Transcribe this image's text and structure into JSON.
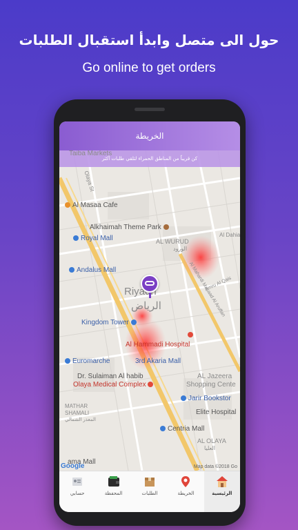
{
  "promo": {
    "title_ar": "حول الى متصل وابدأ استقبال الطلبات",
    "title_en": "Go online to get orders"
  },
  "screen": {
    "app_title": "الخريطة",
    "banner": "كن قريباً من المناطق الحمراء لتلقي طلبات أكثر"
  },
  "map": {
    "labels": {
      "taiba": "Taiba Markets",
      "al_masaa": "Al Masaa Cafe",
      "alkhaimah": "Alkhaimah Theme Park",
      "royal_mall": "Royal Mall",
      "al_wurud": "AL WURUD",
      "al_wurud_ar": "الورود",
      "al_dahia": "Al Dahia",
      "andalus": "Andalus Mall",
      "al_mahardi": "Al Mahardi Masaad Al Aruffan",
      "amru": "Amru Al Qais",
      "riyadh": "Riyadh",
      "riyadh_ar": "الرياض",
      "kingdom": "Kingdom Tower",
      "hammadi": "Al Hammadi Hospital",
      "euromarche": "Euromarche",
      "akaria": "3rd Akaria Mall",
      "sulaiman1": "Dr. Sulaiman Al habib",
      "sulaiman2": "Olaya Medical Complex",
      "aljazeera": "AL Jazeera",
      "shopping": "Shopping Cente",
      "jarir": "Jarir Bookstor",
      "mathar": "MATHAR",
      "shamali": "SHAMALI",
      "mathar_ar": "المعذر الشمالي",
      "elite": "Elite Hospital",
      "centria": "Centria Mall",
      "al_olaya": "AL OLAYA",
      "al_olaya_ar": "العليا",
      "ama_mall": "ama Mall",
      "olaya_st": "Olaya St",
      "google": "Google",
      "copyright": "Map data ©2018 Go"
    }
  },
  "tabs": [
    {
      "label": "الرئيسية",
      "icon": "home-icon",
      "active": true
    },
    {
      "label": "الخريطة",
      "icon": "map-pin-icon",
      "active": false
    },
    {
      "label": "الطلبات",
      "icon": "box-icon",
      "active": false
    },
    {
      "label": "المحفظة",
      "icon": "wallet-icon",
      "active": false
    },
    {
      "label": "حسابي",
      "icon": "account-icon",
      "active": false
    }
  ],
  "colors": {
    "accent": "#8a5cd1",
    "heat": "#ff3b3b",
    "road_main": "#f2c76a"
  }
}
